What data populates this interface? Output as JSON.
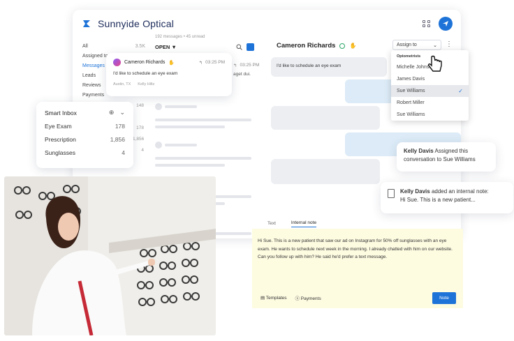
{
  "brand": {
    "name": "Sunnyide Optical",
    "accent": "#1e73d8"
  },
  "nav": [
    {
      "label": "All",
      "count": "3.5K"
    },
    {
      "label": "Assigned to me",
      "count": "18"
    },
    {
      "label": "Messages",
      "count": ""
    },
    {
      "label": "Leads",
      "count": ""
    },
    {
      "label": "Reviews",
      "count": ""
    },
    {
      "label": "Payments",
      "count": ""
    }
  ],
  "nav_counts_extra": [
    "148",
    "178",
    "1,856",
    "4"
  ],
  "list": {
    "meta": "192 messages • 45 unread",
    "filter": "OPEN ▼"
  },
  "message_card": {
    "name": "Cameron Richards",
    "time": "03:25 PM",
    "text": "I'd like to schedule an eye exam",
    "location": "Austin, TX",
    "assignee": "Kelly Hiltz",
    "peek_time": "03:25 PM",
    "peek_text": "aget dui."
  },
  "smart_inbox": {
    "title": "Smart Inbox",
    "items": [
      {
        "label": "Eye Exam",
        "count": "178"
      },
      {
        "label": "Prescription",
        "count": "1,856"
      },
      {
        "label": "Sunglasses",
        "count": "4"
      }
    ]
  },
  "conversation": {
    "name": "Cameron Richards",
    "incoming": "I'd like to schedule an eye exam",
    "assign_label": "Assign to"
  },
  "assign_dropdown": {
    "group": "Optometrists",
    "options": [
      {
        "label": "Michelle Johnson",
        "selected": false
      },
      {
        "label": "James Davis",
        "selected": false
      },
      {
        "label": "Sue Williams",
        "selected": true
      },
      {
        "label": "Robert Miller",
        "selected": false
      },
      {
        "label": "Sue Williams",
        "selected": false
      }
    ]
  },
  "activity": {
    "assigned_actor": "Kelly Davis",
    "assigned_text": "Assigned this conversation to Sue Williams",
    "note_actor": "Kelly Davis",
    "note_text": "added an internal note:",
    "note_preview": "Hi Sue. This is a new patient..."
  },
  "editor": {
    "tabs": [
      "Text",
      "Internal note"
    ],
    "body": "Hi Sue. This is a new patient that saw our ad on Instagram for 50% off sunglasses with an eye exam. He wants to schedule next week in the morning. I already chatted with him on our website. Can you follow up with him? He said he'd prefer a text message.",
    "templates_label": "Templates",
    "payments_label": "Payments",
    "submit_label": "Note"
  }
}
